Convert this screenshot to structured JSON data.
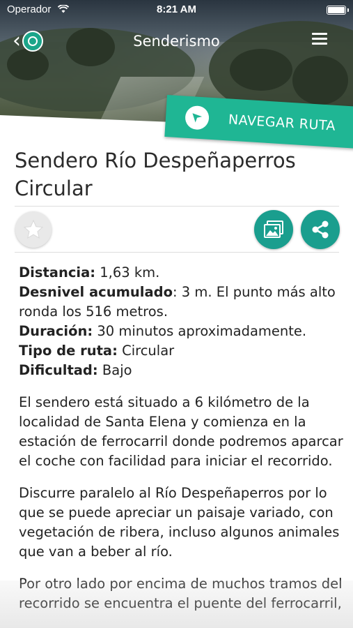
{
  "status_bar": {
    "carrier": "Operador",
    "time": "8:21 AM"
  },
  "header": {
    "title": "Senderismo"
  },
  "navigate_button": {
    "label": "NAVEGAR RUTA"
  },
  "route": {
    "title_line1": "Sendero Río Despeñaperros",
    "title_line2": "Circular"
  },
  "actions": {
    "favorite_icon": "star-icon",
    "gallery_icon": "image-icon",
    "share_icon": "share-icon"
  },
  "details": [
    {
      "label": "Distancia:",
      "value": " 1,63 km."
    },
    {
      "label": "Desnivel acumulado",
      "value": ": 3 m. El punto más alto"
    },
    {
      "label": "",
      "value": "ronda los 516 metros."
    },
    {
      "label": "Duración:",
      "value": " 30 minutos aproximadamente."
    },
    {
      "label": "Tipo de ruta:",
      "value": " Circular"
    },
    {
      "label": "Dificultad:",
      "value": " Bajo"
    }
  ],
  "paragraphs": [
    [
      "El sendero está situado a 6 kilómetro de la",
      "localidad de Santa Elena y comienza en la",
      "estación de ferrocarril donde podremos aparcar",
      "el coche con facilidad para iniciar el recorrido."
    ],
    [
      "Discurre paralelo al Río Despeñaperros por lo",
      "que se puede apreciar un paisaje variado, con",
      "vegetación de ribera, incluso algunos animales",
      "que van a beber al río."
    ],
    [
      "Por otro lado por encima de muchos tramos del",
      "recorrido se encuentra el puente del ferrocarril,"
    ]
  ],
  "colors": {
    "accent": "#1fb694",
    "button_teal": "#1a9e8e"
  }
}
